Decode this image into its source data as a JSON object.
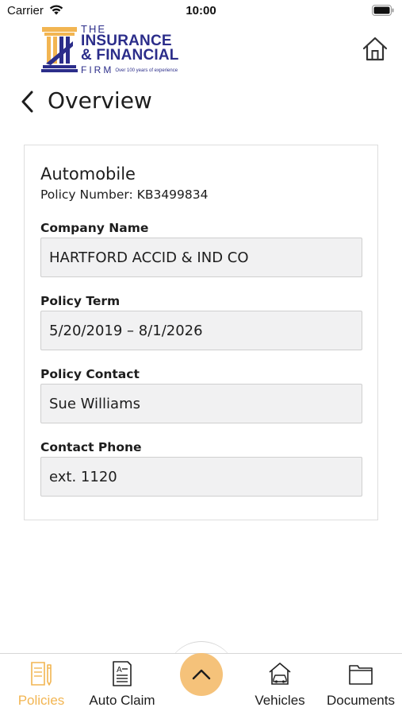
{
  "status_bar": {
    "carrier": "Carrier",
    "time": "10:00"
  },
  "logo": {
    "line_the": "THE",
    "line_insurance": "INSURANCE",
    "line_financial": "& FINANCIAL",
    "line_firm": "FIRM",
    "tagline": "Over 100 years of experience",
    "colors": {
      "navy": "#2b2d8a",
      "gold": "#f2b552"
    }
  },
  "header": {
    "title": "Overview"
  },
  "policy": {
    "type": "Automobile",
    "number_text": "Policy Number: KB3499834",
    "fields": [
      {
        "label": "Company Name",
        "value": "HARTFORD ACCID & IND CO"
      },
      {
        "label": "Policy Term",
        "value": "5/20/2019 – 8/1/2026"
      },
      {
        "label": "Policy Contact",
        "value": "Sue Williams"
      },
      {
        "label": "Contact Phone",
        "value": "ext. 1120"
      }
    ]
  },
  "tab_bar": {
    "tabs": [
      {
        "label": "Policies",
        "icon": "policies-icon",
        "active": true
      },
      {
        "label": "Auto Claim",
        "icon": "auto-claim-icon",
        "active": false
      },
      {
        "label": "Vehicles",
        "icon": "car-icon",
        "active": false
      },
      {
        "label": "Documents",
        "icon": "folder-icon",
        "active": false
      }
    ],
    "center_icon": "chevron-up-icon",
    "accent_color": "#f2b552"
  }
}
